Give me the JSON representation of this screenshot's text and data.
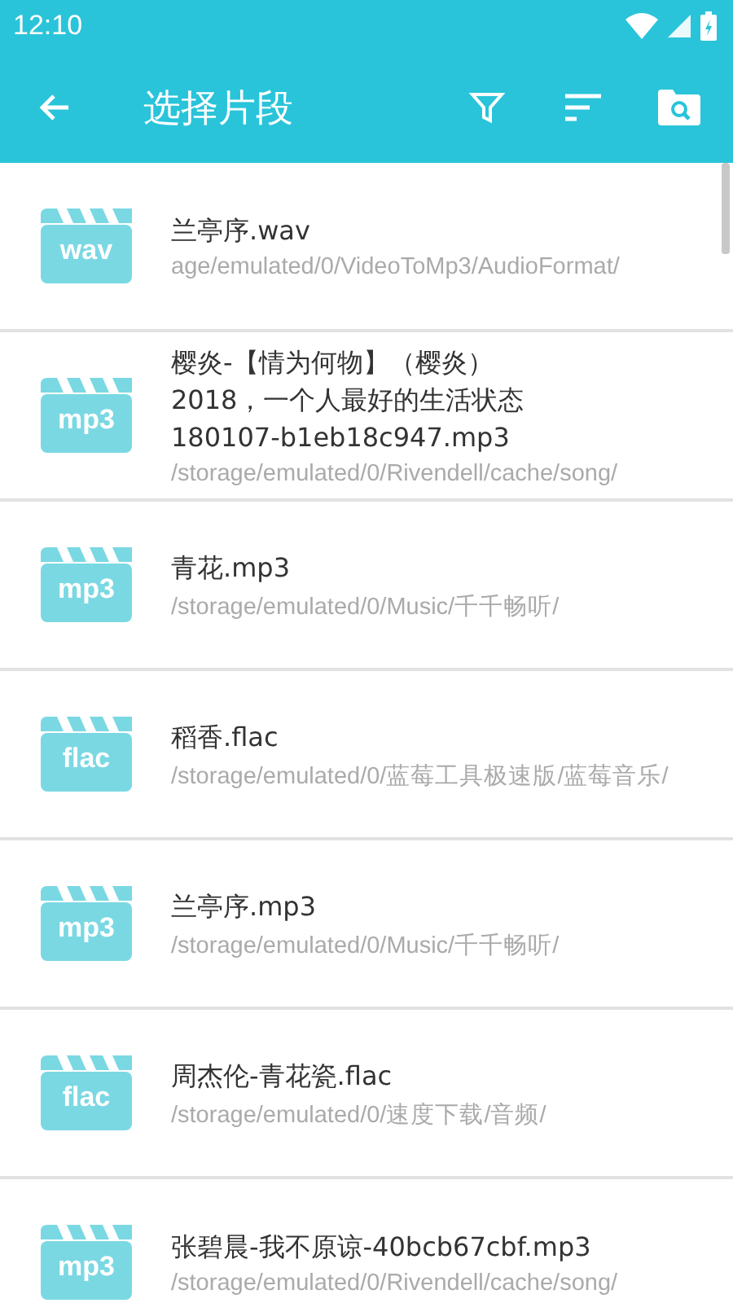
{
  "status_bar": {
    "time": "12:10"
  },
  "toolbar": {
    "title": "选择片段"
  },
  "files": [
    {
      "format": "wav",
      "name": "兰亭序.wav",
      "path": "age/emulated/0/VideoToMp3/AudioFormat/"
    },
    {
      "format": "mp3",
      "name": "樱炎-【情为何物】（樱炎）\n2018，一个人最好的生活状态\n180107-b1eb18c947.mp3",
      "path": "/storage/emulated/0/Rivendell/cache/song/"
    },
    {
      "format": "mp3",
      "name": "青花.mp3",
      "path": "/storage/emulated/0/Music/千千畅听/"
    },
    {
      "format": "flac",
      "name": "稻香.flac",
      "path": "/storage/emulated/0/蓝莓工具极速版/蓝莓音乐/"
    },
    {
      "format": "mp3",
      "name": "兰亭序.mp3",
      "path": "/storage/emulated/0/Music/千千畅听/"
    },
    {
      "format": "flac",
      "name": "周杰伦-青花瓷.flac",
      "path": "/storage/emulated/0/速度下载/音频/"
    },
    {
      "format": "mp3",
      "name": "张碧晨-我不原谅-40bcb67cbf.mp3",
      "path": "/storage/emulated/0/Rivendell/cache/song/"
    }
  ]
}
